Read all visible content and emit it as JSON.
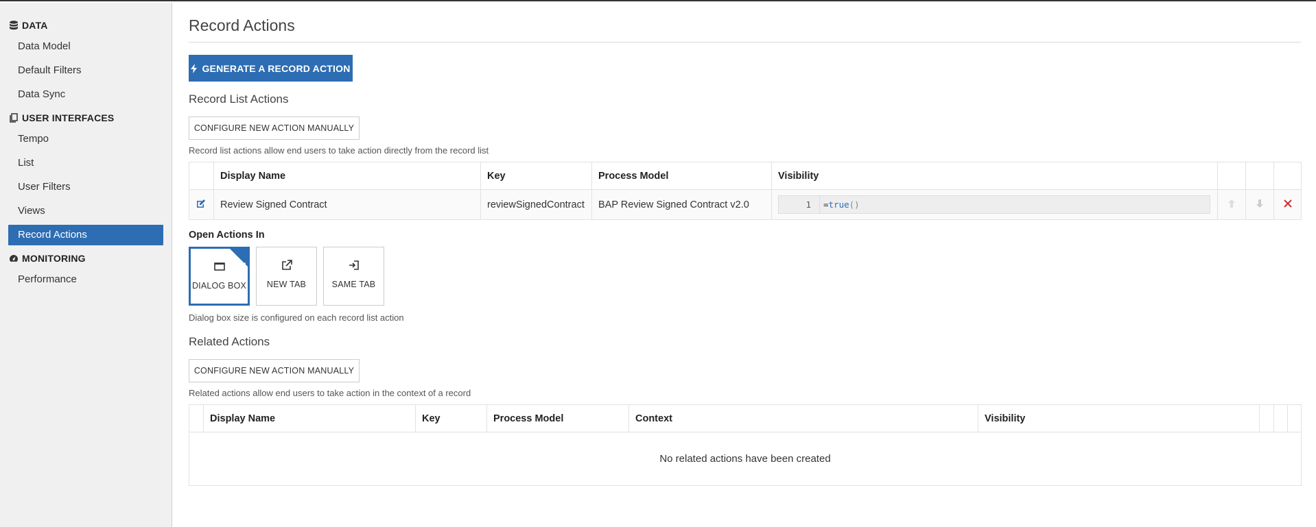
{
  "sidebar": {
    "sections": [
      {
        "title": "DATA",
        "icon": "database-icon",
        "items": [
          "Data Model",
          "Default Filters",
          "Data Sync"
        ]
      },
      {
        "title": "USER INTERFACES",
        "icon": "copy-icon",
        "items": [
          "Tempo",
          "List",
          "User Filters",
          "Views",
          "Record Actions"
        ]
      },
      {
        "title": "MONITORING",
        "icon": "dashboard-icon",
        "items": [
          "Performance"
        ]
      }
    ],
    "active_item": "Record Actions"
  },
  "main": {
    "title": "Record Actions",
    "generate_button": "GENERATE A RECORD ACTION",
    "record_list": {
      "heading": "Record List Actions",
      "configure_button": "CONFIGURE NEW ACTION MANUALLY",
      "help": "Record list actions allow end users to take action directly from the record list",
      "columns": [
        "Display Name",
        "Key",
        "Process Model",
        "Visibility"
      ],
      "rows": [
        {
          "display_name": "Review Signed Contract",
          "key": "reviewSignedContract",
          "process_model": "BAP Review Signed Contract v2.0",
          "visibility_line": "1",
          "visibility_expr_eq": "=",
          "visibility_expr_fn": "true",
          "visibility_expr_par": "()"
        }
      ]
    },
    "open_in": {
      "label": "Open Actions In",
      "options": [
        "DIALOG BOX",
        "NEW TAB",
        "SAME TAB"
      ],
      "selected": "DIALOG BOX",
      "help": "Dialog box size is configured on each record list action"
    },
    "related": {
      "heading": "Related Actions",
      "configure_button": "CONFIGURE NEW ACTION MANUALLY",
      "help": "Related actions allow end users to take action in the context of a record",
      "columns": [
        "Display Name",
        "Key",
        "Process Model",
        "Context",
        "Visibility"
      ],
      "empty": "No related actions have been created"
    }
  },
  "colors": {
    "accent": "#2d6db3",
    "delete": "#c9302c"
  }
}
